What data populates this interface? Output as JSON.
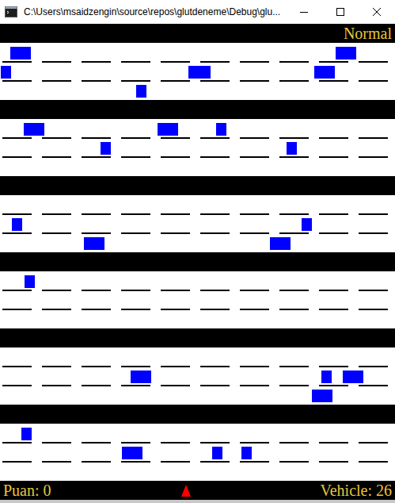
{
  "window": {
    "title": "C:\\Users\\msaidzengin\\source\\repos\\glutdeneme\\Debug\\glu..."
  },
  "game": {
    "mode": "Normal",
    "score": "Puan: 0",
    "vehicles": "Vehicle: 26"
  }
}
